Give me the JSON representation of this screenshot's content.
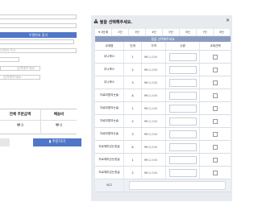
{
  "left": {
    "zip_button_label": "우편번호 찾기",
    "address_placeholder": "나머지 주소",
    "recipient_placeholder": "입력해주세요.",
    "memo_placeholder": "입력해주세요.",
    "summary": {
      "total_header": "전체 주문금액",
      "shipping_header": "배송비",
      "total_value": "0",
      "shipping_value": "0",
      "currency_symbol": "₩"
    },
    "order_button_label": "주문하기"
  },
  "modal": {
    "title": "필을 선택해주세요.",
    "close_icon": "close-icon",
    "tabs": [
      "1단계",
      "2단",
      "3단",
      "4단",
      "5단",
      "6단",
      "7단",
      "8단"
    ],
    "grid_title": "필을 선택해주세요",
    "columns": [
      "교재명",
      "단계",
      "가격",
      "수량",
      "교재선택"
    ],
    "rows": [
      {
        "name": "무니북스",
        "level": "1",
        "price": "12,000"
      },
      {
        "name": "무니북스",
        "level": "2",
        "price": "12,000"
      },
      {
        "name": "무니북스",
        "level": "3",
        "price": "12,000"
      },
      {
        "name": "자료마법의논술",
        "level": "A",
        "price": "12,000"
      },
      {
        "name": "자료마법의논술",
        "level": "1",
        "price": "12,000"
      },
      {
        "name": "자료마법의논술",
        "level": "2",
        "price": "12,000"
      },
      {
        "name": "자료마법의논술",
        "level": "3",
        "price": "12,000"
      },
      {
        "name": "자료재미있는한글",
        "level": "A",
        "price": "12,000"
      },
      {
        "name": "자료재미있는한글",
        "level": "1",
        "price": "12,000"
      },
      {
        "name": "자료재미있는한글",
        "level": "2",
        "price": "12,000"
      }
    ],
    "note_label": "비고"
  },
  "colors": {
    "accent_blue": "#4f76c8",
    "panel_bg": "#e7ebf0",
    "grid_title_bg": "#8b9bc0"
  }
}
